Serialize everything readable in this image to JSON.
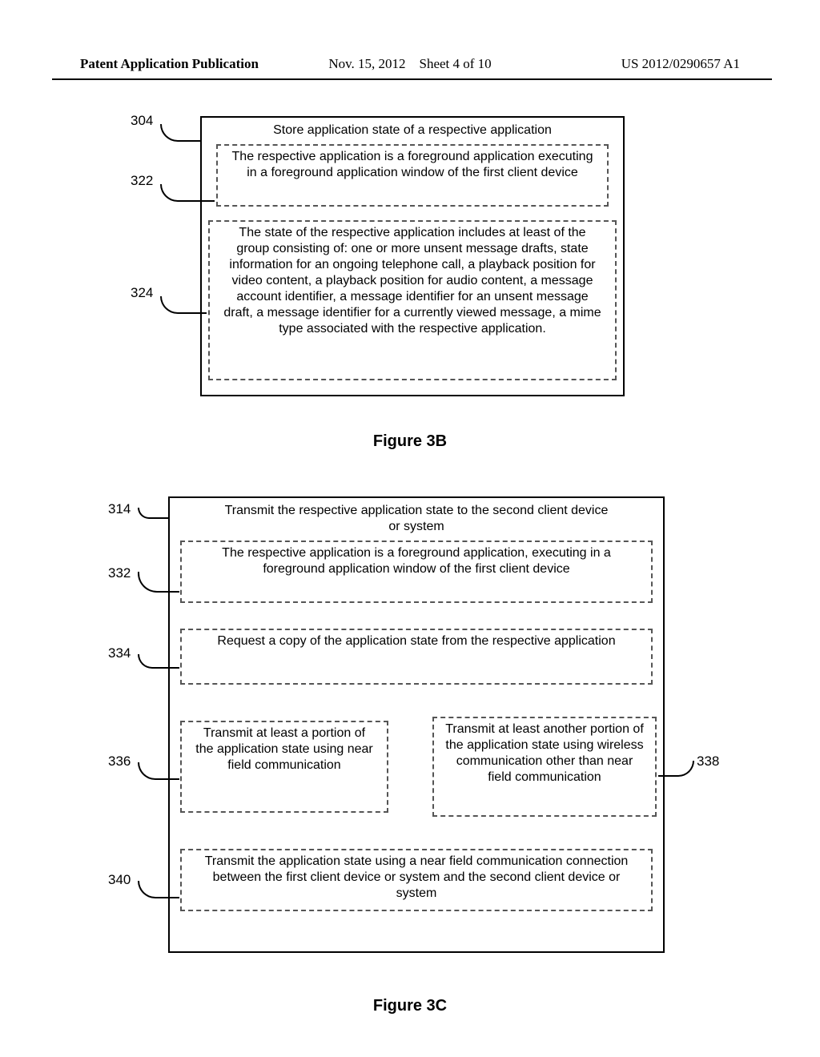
{
  "header": {
    "left": "Patent Application Publication",
    "date": "Nov. 15, 2012",
    "sheet": "Sheet 4 of 10",
    "pubno": "US 2012/0290657 A1"
  },
  "fig3b": {
    "caption": "Figure 3B",
    "box304": {
      "ref": "304",
      "title": "Store application state of a respective application"
    },
    "box322": {
      "ref": "322",
      "text": "The respective application is a foreground application executing in a foreground application window of the first client device"
    },
    "box324": {
      "ref": "324",
      "text": "The state of the respective application includes at least of the group consisting of: one or more unsent message drafts, state information for an ongoing telephone call, a playback position for video content, a playback position for audio content, a message account identifier, a message identifier for an unsent message draft, a message identifier for a currently viewed message, a mime type associated with the respective application."
    }
  },
  "fig3c": {
    "caption": "Figure 3C",
    "box314": {
      "ref": "314",
      "title": "Transmit the respective application state  to the second client device or system"
    },
    "box332": {
      "ref": "332",
      "text": "The respective application is a foreground application, executing in a foreground application window of the first client device"
    },
    "box334": {
      "ref": "334",
      "text": "Request a copy of the application state from the respective application"
    },
    "box336": {
      "ref": "336",
      "text": "Transmit at least a portion of the application state using near field communication"
    },
    "box338": {
      "ref": "338",
      "text": "Transmit at least another portion of the application state using wireless communication other than near field communication"
    },
    "box340": {
      "ref": "340",
      "text": "Transmit the application state using a near field communication connection between the first client device or system and the second client device or system"
    }
  }
}
